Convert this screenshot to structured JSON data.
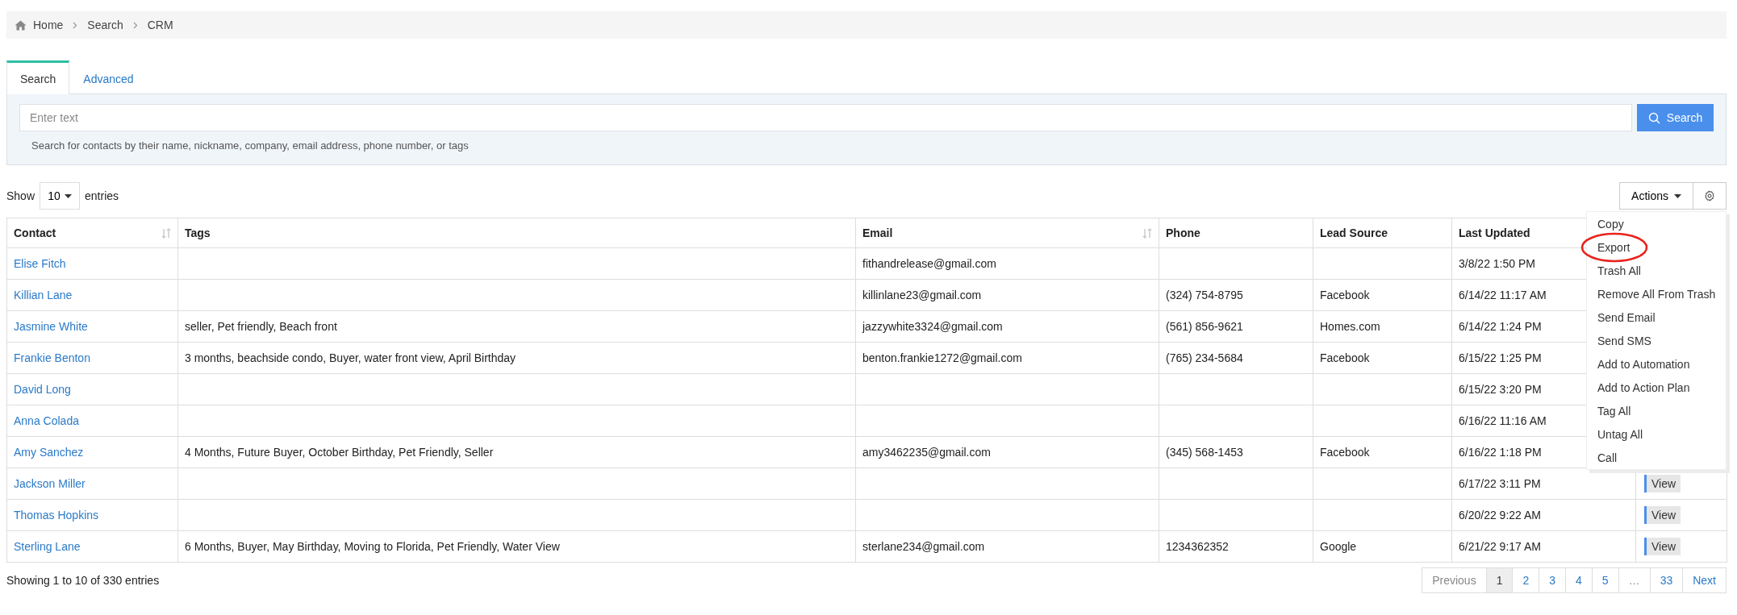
{
  "breadcrumb": [
    {
      "label": "Home",
      "kind": "home"
    },
    {
      "label": "Search",
      "kind": "link"
    },
    {
      "label": "CRM",
      "kind": "link"
    }
  ],
  "tabs": [
    {
      "label": "Search",
      "selected": true
    },
    {
      "label": "Advanced",
      "selected": false
    }
  ],
  "search": {
    "placeholder": "Enter text",
    "button": "Search",
    "help": "Search for contacts by their name, nickname, company, email address, phone number, or tags"
  },
  "length_menu": {
    "before": "Show",
    "value": "10",
    "after": "entries"
  },
  "toolbar": {
    "actions_label": "Actions"
  },
  "actions_menu": [
    {
      "label": "Copy",
      "highlighted": false
    },
    {
      "label": "Export",
      "highlighted": true
    },
    {
      "label": "Trash All",
      "highlighted": false
    },
    {
      "label": "Remove All From Trash",
      "highlighted": false
    },
    {
      "label": "Send Email",
      "highlighted": false
    },
    {
      "label": "Send SMS",
      "highlighted": false
    },
    {
      "label": "Add to Automation",
      "highlighted": false
    },
    {
      "label": "Add to Action Plan",
      "highlighted": false
    },
    {
      "label": "Tag All",
      "highlighted": false
    },
    {
      "label": "Untag All",
      "highlighted": false
    },
    {
      "label": "Call",
      "highlighted": false
    }
  ],
  "table": {
    "columns": [
      {
        "label": "Contact",
        "sortable": true
      },
      {
        "label": "Tags",
        "sortable": false
      },
      {
        "label": "Email",
        "sortable": true
      },
      {
        "label": "Phone",
        "sortable": false
      },
      {
        "label": "Lead Source",
        "sortable": false
      },
      {
        "label": "Last Updated",
        "sortable": false
      }
    ],
    "rows": [
      {
        "contact": "Elise Fitch",
        "email": "fithandrelease@gmail.com",
        "last_updated": "3/8/22 1:50 PM"
      },
      {
        "contact": "Killian Lane",
        "email": "killinlane23@gmail.com",
        "phone": "(324) 754-8795",
        "lead_source": "Facebook",
        "last_updated": "6/14/22 11:17 AM"
      },
      {
        "contact": "Jasmine White",
        "tags": "seller, Pet friendly, Beach front",
        "email": "jazzywhite3324@gmail.com",
        "phone": "(561) 856-9621",
        "lead_source": "Homes.com",
        "last_updated": "6/14/22 1:24 PM"
      },
      {
        "contact": "Frankie Benton",
        "tags": "3 months, beachside condo, Buyer, water front view, April Birthday",
        "email": "benton.frankie1272@gmail.com",
        "phone": "(765) 234-5684",
        "lead_source": "Facebook",
        "last_updated": "6/15/22 1:25 PM"
      },
      {
        "contact": "David Long",
        "last_updated": "6/15/22 3:20 PM"
      },
      {
        "contact": "Anna Colada",
        "last_updated": "6/16/22 11:16 AM"
      },
      {
        "contact": "Amy Sanchez",
        "tags": "4 Months, Future Buyer, October Birthday, Pet Friendly, Seller",
        "email": "amy3462235@gmail.com",
        "phone": "(345) 568-1453",
        "lead_source": "Facebook",
        "last_updated": "6/16/22 1:18 PM"
      },
      {
        "contact": "Jackson Miller",
        "last_updated": "6/17/22 3:11 PM",
        "action": "View"
      },
      {
        "contact": "Thomas Hopkins",
        "last_updated": "6/20/22 9:22 AM",
        "action": "View"
      },
      {
        "contact": "Sterling Lane",
        "tags": "6 Months, Buyer, May Birthday, Moving to Florida, Pet Friendly, Water View",
        "email": "sterlane234@gmail.com",
        "phone": "1234362352",
        "lead_source": "Google",
        "last_updated": "6/21/22 9:17 AM",
        "action": "View"
      }
    ]
  },
  "info": "Showing 1 to 10 of 330 entries",
  "pagination": [
    {
      "label": "Previous",
      "selected": false,
      "disabled": true
    },
    {
      "label": "1",
      "selected": true,
      "disabled": false
    },
    {
      "label": "2",
      "selected": false,
      "disabled": false
    },
    {
      "label": "3",
      "selected": false,
      "disabled": false
    },
    {
      "label": "4",
      "selected": false,
      "disabled": false
    },
    {
      "label": "5",
      "selected": false,
      "disabled": false
    },
    {
      "label": "…",
      "selected": false,
      "disabled": true
    },
    {
      "label": "33",
      "selected": false,
      "disabled": false
    },
    {
      "label": "Next",
      "selected": false,
      "disabled": false
    }
  ]
}
